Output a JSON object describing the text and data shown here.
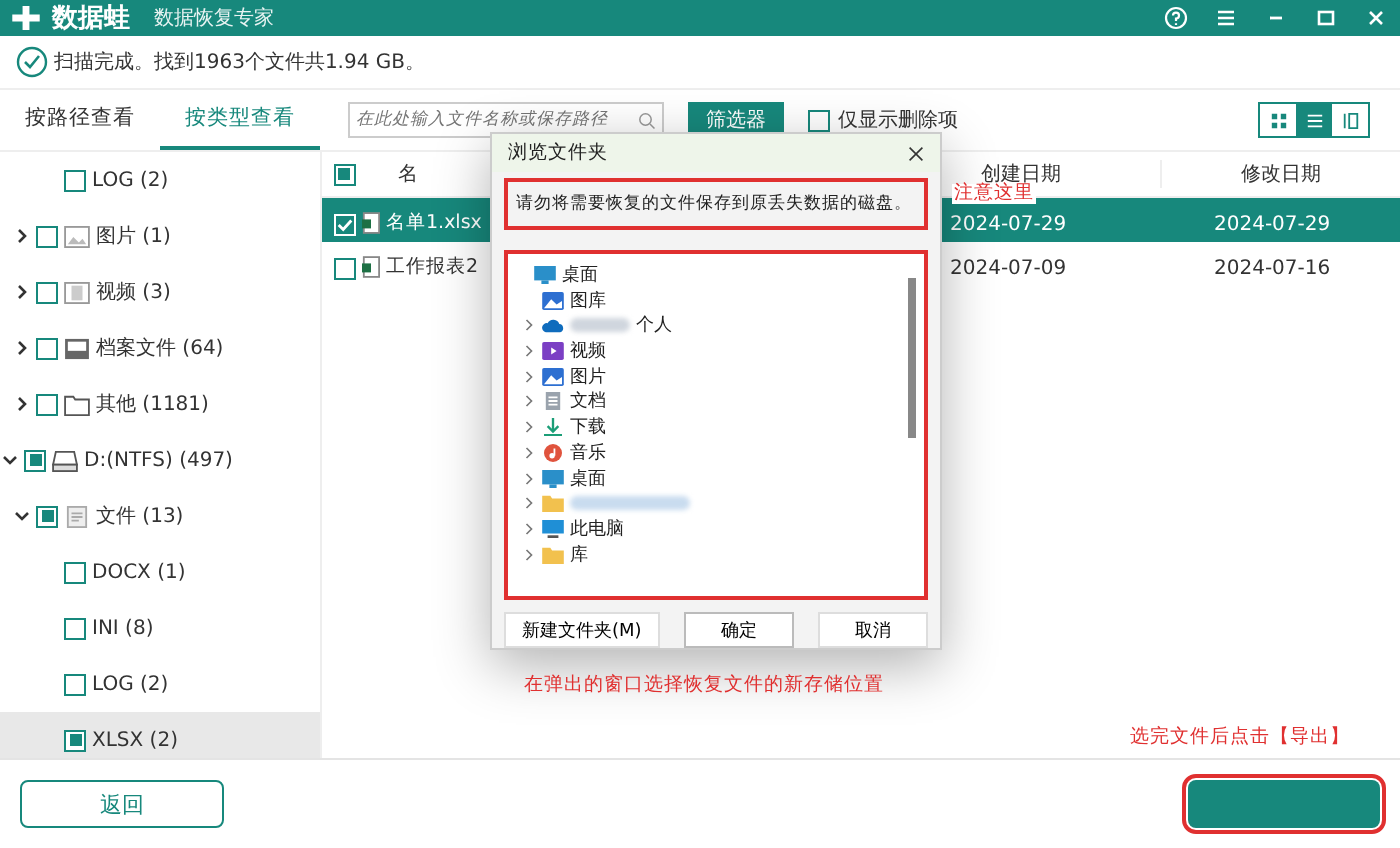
{
  "header": {
    "logo": "数据蛙",
    "subtitle": "数据恢复专家"
  },
  "status": {
    "message": "扫描完成。找到1963个文件共1.94 GB。"
  },
  "tabs": [
    {
      "label": "按路径查看",
      "selected": false
    },
    {
      "label": "按类型查看",
      "selected": true
    }
  ],
  "search": {
    "placeholder": "在此处输入文件名称或保存路径"
  },
  "filter_button": "筛选器",
  "deleted_only": {
    "label": "仅显示删除项",
    "checked": false
  },
  "view_modes": [
    {
      "kind": "grid",
      "selected": false
    },
    {
      "kind": "list",
      "selected": true
    },
    {
      "kind": "detail",
      "selected": false
    }
  ],
  "tree": [
    {
      "children": [
        {
          "children": [
            {
              "label": "LOG (2)",
              "checked": false,
              "partial": false,
              "selected": false
            }
          ]
        },
        {
          "label": "图片 (1)",
          "kind": "image",
          "checked": false,
          "partial": false,
          "expanded": false,
          "selected": false
        },
        {
          "label": "视频 (3)",
          "kind": "video",
          "checked": false,
          "partial": false,
          "expanded": false,
          "selected": false
        },
        {
          "label": "档案文件 (64)",
          "kind": "archive",
          "checked": false,
          "partial": false,
          "expanded": false,
          "selected": false
        },
        {
          "label": "其他 (1181)",
          "kind": "folder",
          "checked": false,
          "partial": false,
          "expanded": false,
          "selected": false
        }
      ]
    },
    {
      "label": "D:(NTFS) (497)",
      "kind": "drive",
      "checked": false,
      "partial": true,
      "expanded": true,
      "selected": false,
      "children": [
        {
          "label": "文件 (13)",
          "kind": "document",
          "checked": false,
          "partial": true,
          "expanded": true,
          "selected": false,
          "children": [
            {
              "label": "DOCX (1)",
              "checked": false,
              "partial": false,
              "selected": false
            },
            {
              "label": "INI (8)",
              "checked": false,
              "partial": false,
              "selected": false
            },
            {
              "label": "LOG (2)",
              "checked": false,
              "partial": false,
              "selected": false
            },
            {
              "label": "XLSX (2)",
              "checked": false,
              "partial": true,
              "selected": true
            }
          ]
        }
      ]
    }
  ],
  "table": {
    "header_checked": false,
    "header_partial": true,
    "columns": [
      "名",
      "创建日期",
      "修改日期"
    ],
    "rows": [
      {
        "name": "名单1.xlsx",
        "created": "2024-07-29",
        "modified": "2024-07-29",
        "checked": true,
        "selected": true
      },
      {
        "name": "工作报表2",
        "created": "2024-07-09",
        "modified": "2024-07-16",
        "checked": false,
        "selected": false
      }
    ]
  },
  "dialog": {
    "title": "浏览文件夹",
    "message": "请勿将需要恢复的文件保存到原丢失数据的磁盘。",
    "note": "注意这里",
    "folders": [
      {
        "label": "桌面",
        "kind": "desktop",
        "expandable": false,
        "children": [
          {
            "label": "图库",
            "kind": "gallery",
            "expandable": false
          },
          {
            "label": "个人",
            "kind": "cloud",
            "expandable": true,
            "blurred": true
          },
          {
            "label": "视频",
            "kind": "video",
            "expandable": true,
            "blurred": false
          },
          {
            "label": "图片",
            "kind": "gallery",
            "expandable": true,
            "blurred": false
          },
          {
            "label": "文档",
            "kind": "document",
            "expandable": true,
            "blurred": false
          },
          {
            "label": "下载",
            "kind": "download",
            "expandable": true,
            "blurred": false
          },
          {
            "label": "音乐",
            "kind": "music",
            "expandable": true,
            "blurred": false
          },
          {
            "label": "桌面",
            "kind": "desktop",
            "expandable": true,
            "blurred": false
          },
          {
            "kind": "folder",
            "expandable": true,
            "blurred": true
          },
          {
            "label": "此电脑",
            "kind": "pc",
            "expandable": true,
            "blurred": false
          },
          {
            "label": "库",
            "kind": "folder",
            "expandable": true,
            "blurred": false
          }
        ]
      }
    ],
    "buttons": [
      {
        "label": "新建文件夹(M)",
        "default": false
      },
      {
        "label": "确定",
        "default": true
      },
      {
        "label": "取消",
        "default": false
      }
    ]
  },
  "hint": "在弹出的窗口选择恢复文件的新存储位置",
  "export_hint": "选完文件后点击【导出】",
  "footer": {
    "back_button": "返回",
    "export_button": {
      "highlighted": true
    }
  }
}
